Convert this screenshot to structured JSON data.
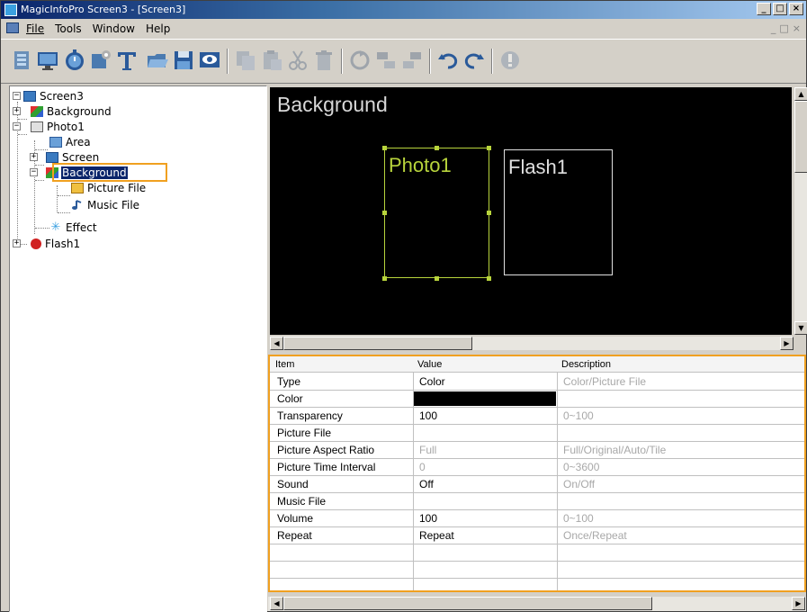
{
  "window": {
    "title": "MagicInfoPro Screen3 - [Screen3]",
    "controls": [
      "_",
      "□",
      "×"
    ]
  },
  "menubar": {
    "items": [
      "File",
      "Tools",
      "Window",
      "Help"
    ],
    "mdi_controls": [
      "_",
      "□",
      "×"
    ]
  },
  "toolbar": {
    "icons": [
      "add-background-icon",
      "add-screen-icon",
      "add-timer-icon",
      "add-effect-icon",
      "add-text-icon",
      "open-icon",
      "save-icon",
      "preview-icon",
      "copy-icon",
      "paste-icon",
      "cut-icon",
      "delete-icon",
      "reset-icon",
      "align-icon",
      "align-alt-icon",
      "undo-icon",
      "redo-icon",
      "info-icon"
    ]
  },
  "tree": {
    "root": "Screen3",
    "items": [
      {
        "label": "Background"
      },
      {
        "label": "Photo1"
      },
      {
        "label": "Area"
      },
      {
        "label": "Screen"
      },
      {
        "label": "Background"
      },
      {
        "label": "Picture File"
      },
      {
        "label": "Music File"
      },
      {
        "label": "Effect"
      },
      {
        "label": "Flash1"
      }
    ]
  },
  "canvas": {
    "title": "Background",
    "regions": [
      {
        "label": "Photo1",
        "color": "#b8d43c"
      },
      {
        "label": "Flash1",
        "color": "#e0e0e0"
      }
    ]
  },
  "properties": {
    "headers": {
      "item": "Item",
      "value": "Value",
      "description": "Description"
    },
    "rows": [
      {
        "item": "Type",
        "value": "Color",
        "description": "Color/Picture File"
      },
      {
        "item": "Color",
        "value": "",
        "description": ""
      },
      {
        "item": "Transparency",
        "value": "100",
        "description": "0~100"
      },
      {
        "item": "Picture File",
        "value": "",
        "description": ""
      },
      {
        "item": "Picture Aspect Ratio",
        "value": "Full",
        "description": "Full/Original/Auto/Tile"
      },
      {
        "item": "Picture Time Interval",
        "value": "0",
        "description": "0~3600"
      },
      {
        "item": "Sound",
        "value": "Off",
        "description": "On/Off"
      },
      {
        "item": "Music File",
        "value": "",
        "description": ""
      },
      {
        "item": "Volume",
        "value": "100",
        "description": "0~100"
      },
      {
        "item": "Repeat",
        "value": "Repeat",
        "description": "Once/Repeat"
      }
    ]
  },
  "colors": {
    "highlight": "#f0a020",
    "selection": "#0a246a",
    "photo_region": "#b8d43c",
    "color_value": "#000000"
  }
}
